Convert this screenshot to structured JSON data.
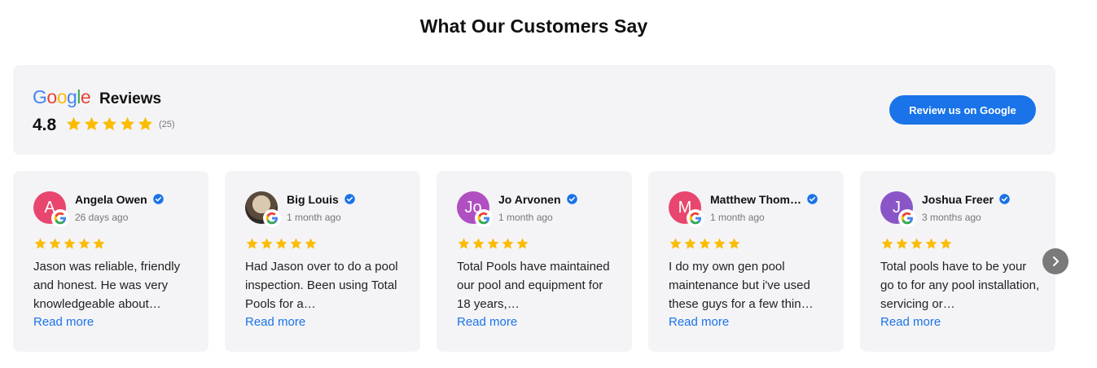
{
  "page": {
    "title": "What Our Customers Say"
  },
  "summary": {
    "logo_letters": [
      {
        "ch": "G",
        "color": "#4285F4"
      },
      {
        "ch": "o",
        "color": "#EA4335"
      },
      {
        "ch": "o",
        "color": "#FBBC05"
      },
      {
        "ch": "g",
        "color": "#4285F4"
      },
      {
        "ch": "l",
        "color": "#34A853"
      },
      {
        "ch": "e",
        "color": "#EA4335"
      }
    ],
    "reviews_label": "Reviews",
    "rating": "4.8",
    "stars": 5,
    "count": "(25)",
    "button_label": "Review us on Google"
  },
  "colors": {
    "star": "#FBBC04",
    "accent": "#1a73e8",
    "verified": "#1a73e8"
  },
  "reviews": [
    {
      "name": "Angela Owen",
      "initial": "A",
      "avatar_color": "#e8466e",
      "avatar_type": "initial",
      "date": "26 days ago",
      "stars": 5,
      "text": "Jason was reliable, friendly and honest. He was very knowledgeable about…",
      "read_more": "Read more"
    },
    {
      "name": "Big Louis",
      "initial": "",
      "avatar_color": "#5a4a3a",
      "avatar_type": "photo",
      "date": "1 month ago",
      "stars": 5,
      "text": "Had Jason over to do a pool inspection. Been using Total Pools for a…",
      "read_more": "Read more"
    },
    {
      "name": "Jo Arvonen",
      "initial": "Jo",
      "avatar_color": "#b04fc2",
      "avatar_type": "initial",
      "date": "1 month ago",
      "stars": 5,
      "text": "Total Pools have maintained our pool and equipment for 18 years,…",
      "read_more": "Read more"
    },
    {
      "name": "Matthew Thom…",
      "initial": "M",
      "avatar_color": "#e8466e",
      "avatar_type": "initial",
      "date": "1 month ago",
      "stars": 5,
      "text": "I do my own gen pool maintenance but i've used these guys for a few thin…",
      "read_more": "Read more"
    },
    {
      "name": "Joshua Freer",
      "initial": "J",
      "avatar_color": "#8a56c7",
      "avatar_type": "initial",
      "date": "3 months ago",
      "stars": 5,
      "text": "Total pools have to be your go to for any pool installation, servicing or…",
      "read_more": "Read more"
    }
  ],
  "carousel": {
    "next_icon": "chevron-right-icon"
  }
}
